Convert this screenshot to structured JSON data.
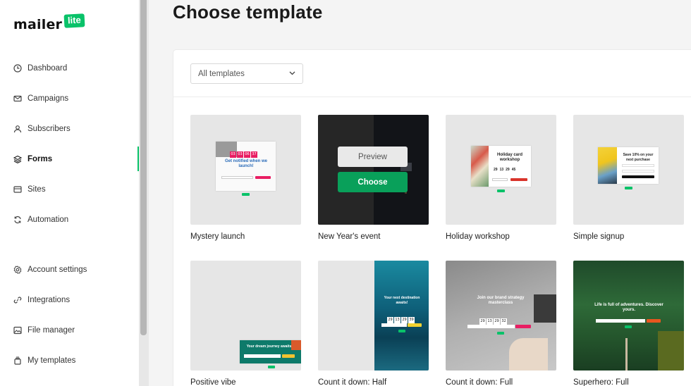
{
  "logo": {
    "text": "mailer",
    "badge": "lite"
  },
  "nav": [
    {
      "label": "Dashboard",
      "icon": "clock-icon"
    },
    {
      "label": "Campaigns",
      "icon": "envelope-icon"
    },
    {
      "label": "Subscribers",
      "icon": "user-icon"
    },
    {
      "label": "Forms",
      "icon": "layers-icon",
      "active": true
    },
    {
      "label": "Sites",
      "icon": "browser-icon"
    },
    {
      "label": "Automation",
      "icon": "refresh-icon"
    },
    {
      "label": "Account settings",
      "icon": "gear-icon"
    },
    {
      "label": "Integrations",
      "icon": "link-icon"
    },
    {
      "label": "File manager",
      "icon": "image-icon"
    },
    {
      "label": "My templates",
      "icon": "stack-icon"
    }
  ],
  "page": {
    "title": "Choose template"
  },
  "filter": {
    "selected": "All templates"
  },
  "templates": [
    {
      "name": "Mystery launch",
      "art": {
        "heading": "Get notified when we launch!",
        "countdown": [
          "03",
          "03",
          "06",
          "37"
        ],
        "button_color": "#e91e63"
      }
    },
    {
      "name": "New Year's event",
      "hover": {
        "preview_label": "Preview",
        "choose_label": "Choose"
      }
    },
    {
      "name": "Holiday workshop",
      "art": {
        "heading": "Holiday card workshop",
        "countdown": [
          "29",
          "13",
          "29",
          "45"
        ]
      }
    },
    {
      "name": "Simple signup",
      "art": {
        "heading": "Save 10% on your next purchase"
      }
    },
    {
      "name": "Positive vibe",
      "art": {
        "heading": "Your dream journey awaits"
      }
    },
    {
      "name": "Count it down: Half",
      "art": {
        "heading": "Your next destination awaits!",
        "countdown": [
          "29",
          "13",
          "29",
          "39"
        ]
      }
    },
    {
      "name": "Count it down: Full",
      "art": {
        "heading": "Join our brand strategy masterclass",
        "countdown": [
          "29",
          "13",
          "29",
          "32"
        ]
      }
    },
    {
      "name": "Superhero: Full",
      "art": {
        "heading": "Life is full of adventures. Discover yours."
      }
    }
  ],
  "colors": {
    "brand_green": "#09c269",
    "choose_green": "#09a05a"
  }
}
